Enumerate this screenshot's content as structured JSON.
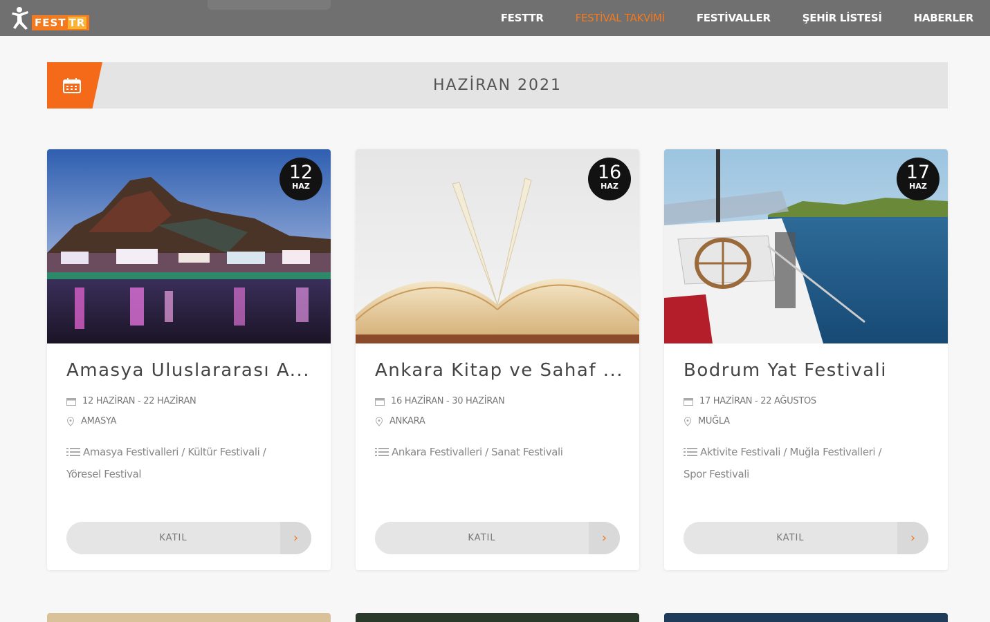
{
  "brand": {
    "logo_text": "FEST",
    "logo_suffix": "TR"
  },
  "nav": {
    "items": [
      {
        "label": "FESTTR",
        "active": false
      },
      {
        "label": "FESTİVAL TAKVİMİ",
        "active": true
      },
      {
        "label": "FESTİVALLER",
        "active": false
      },
      {
        "label": "ŞEHİR LİSTESİ",
        "active": false
      },
      {
        "label": "HABERLER",
        "active": false
      }
    ]
  },
  "banner": {
    "title": "HAZİRAN 2021",
    "icon": "calendar-icon"
  },
  "colors": {
    "accent": "#f47a20",
    "topbar": "#707070",
    "badge": "#121212"
  },
  "cards": [
    {
      "day": "12",
      "month": "HAZ",
      "title": "Amasya Uluslararası Anadolu Festivali",
      "title_display": "Amasya Uluslararası A...",
      "dates": "12 HAZİRAN - 22 HAZİRAN",
      "city": "AMASYA",
      "categories_line1": "Amasya Festivalleri / Kültür Festivali /",
      "categories_line2": "Yöresel Festival",
      "join_label": "KATIL",
      "image": "amasya-night-view"
    },
    {
      "day": "16",
      "month": "HAZ",
      "title": "Ankara Kitap ve Sahaf Festivali",
      "title_display": "Ankara Kitap ve Sahaf ...",
      "dates": "16 HAZİRAN - 30 HAZİRAN",
      "city": "ANKARA",
      "categories_line1": "Ankara Festivalleri / Sanat Festivali",
      "categories_line2": "",
      "join_label": "KATIL",
      "image": "open-book"
    },
    {
      "day": "17",
      "month": "HAZ",
      "title": "Bodrum Yat Festivali",
      "title_display": "Bodrum Yat Festivali",
      "dates": "17 HAZİRAN - 22 AĞUSTOS",
      "city": "MUĞLA",
      "categories_line1": "Aktivite Festivali / Muğla Festivalleri /",
      "categories_line2": "Spor Festivali",
      "join_label": "KATIL",
      "image": "boat-on-water"
    }
  ]
}
